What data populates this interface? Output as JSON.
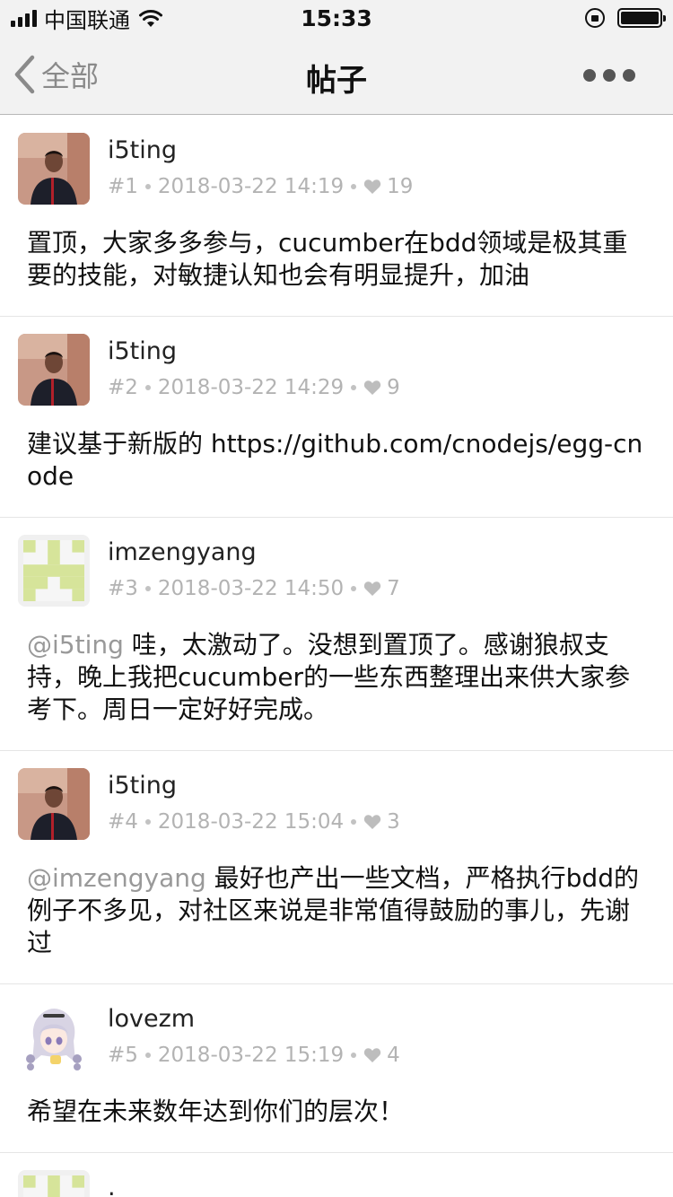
{
  "status_bar": {
    "carrier": "中国联通",
    "time": "15:33"
  },
  "nav": {
    "back_label": "全部",
    "title": "帖子"
  },
  "colors": {
    "nav_bg": "#f2f2f2",
    "meta_text": "#b3b3b3",
    "mention": "#999999",
    "identicon": "#d6e49a"
  },
  "posts": [
    {
      "username": "i5ting",
      "floor": "#1",
      "datetime": "2018-03-22 14:19",
      "likes": "19",
      "avatar": "photo-avatar",
      "mention": "",
      "content": "置顶，大家多多参与，cucumber在bdd领域是极其重要的技能，对敏捷认知也会有明显提升，加油"
    },
    {
      "username": "i5ting",
      "floor": "#2",
      "datetime": "2018-03-22 14:29",
      "likes": "9",
      "avatar": "photo-avatar",
      "mention": "",
      "content": "建议基于新版的 https://github.com/cnodejs/egg-cnode"
    },
    {
      "username": "imzengyang",
      "floor": "#3",
      "datetime": "2018-03-22 14:50",
      "likes": "7",
      "avatar": "identicon-avatar",
      "mention": "@i5ting",
      "content": " 哇，太激动了。没想到置顶了。感谢狼叔支持，晚上我把cucumber的一些东西整理出来供大家参考下。周日一定好好完成。"
    },
    {
      "username": "i5ting",
      "floor": "#4",
      "datetime": "2018-03-22 15:04",
      "likes": "3",
      "avatar": "photo-avatar",
      "mention": "@imzengyang",
      "content": " 最好也产出一些文档，严格执行bdd的例子不多见，对社区来说是非常值得鼓励的事儿，先谢过"
    },
    {
      "username": "lovezm",
      "floor": "#5",
      "datetime": "2018-03-22 15:19",
      "likes": "4",
      "avatar": "anime-avatar",
      "mention": "",
      "content": "希望在未来数年达到你们的层次！"
    },
    {
      "username": ".",
      "floor": "",
      "datetime": "",
      "likes": "",
      "avatar": "identicon-avatar",
      "mention": "",
      "content": ""
    }
  ]
}
